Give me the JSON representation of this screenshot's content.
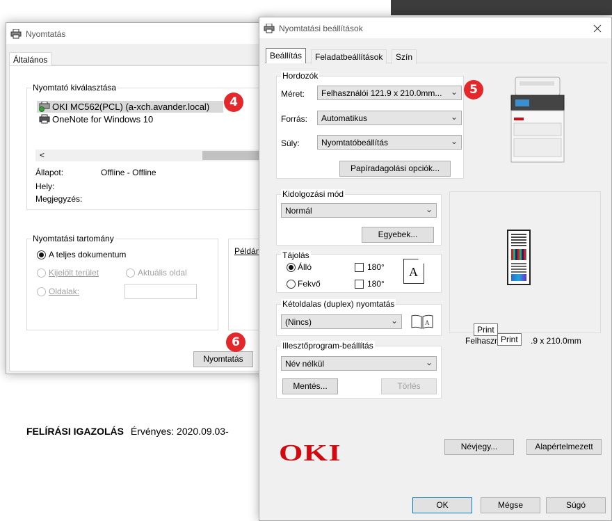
{
  "colors": {
    "badge": "#e3272a",
    "oki_logo": "#d10a10",
    "dark_bar": "#3c3c3c",
    "selection": "#d9d9d9"
  },
  "bg_text": {
    "certificate_label": "FELÍRÁSI IGAZOLÁS",
    "valid_text": "Érvényes: 2020.09.03-"
  },
  "print_dialog": {
    "title": "Nyomtatás",
    "title_icon": "printer-icon",
    "tab": "Általános",
    "select_printer_legend": "Nyomtató kiválasztása",
    "printers": [
      {
        "name": "OKI MC562(PCL) (a-xch.avander.local)",
        "icon": "network-printer-icon",
        "selected": true
      },
      {
        "name": "OneNote for Windows 10",
        "icon": "printer-icon",
        "selected": false
      }
    ],
    "scroll_left": "<",
    "status_label": "Állapot:",
    "status_value": "Offline - Offline",
    "location_label": "Hely:",
    "comment_label": "Megjegyzés:",
    "range_legend": "Nyomtatási tartomány",
    "range_all": "A teljes dokumentum",
    "range_selection": "Kijelölt terület",
    "range_current": "Aktuális oldal",
    "range_pages": "Oldalak:",
    "copies_label": "Példány",
    "print_button": "Nyomtatás"
  },
  "settings_dialog": {
    "title": "Nyomtatási beállítások",
    "title_icon": "printer-icon",
    "close_icon": "close-icon",
    "tabs": [
      "Beállítás",
      "Feladatbeállítások",
      "Szín"
    ],
    "active_tab": 0,
    "media_legend": "Hordozók",
    "size_label": "Méret:",
    "size_value": "Felhasználói 121.9 x 210.0mm...",
    "source_label": "Forrás:",
    "source_value": "Automatikus",
    "weight_label": "Súly:",
    "weight_value": "Nyomtatóbeállítás",
    "paper_feed_button": "Papíradagolási opciók...",
    "finishing_legend": "Kidolgozási mód",
    "finishing_value": "Normál",
    "other_button": "Egyebek...",
    "orientation_legend": "Tájolás",
    "portrait": "Álló",
    "landscape": "Fekvő",
    "rotate180_a": "180°",
    "rotate180_b": "180°",
    "orientation_icon_letter": "A",
    "duplex_legend": "Kétoldalas (duplex) nyomtatás",
    "duplex_value": "(Nincs)",
    "duplex_icon": "book-icon",
    "driver_legend": "Illesztőprogram-beállítás",
    "driver_value": "Név nélkül",
    "save_button": "Mentés...",
    "delete_button": "Törlés",
    "preview_caption_left": "Felhaszn",
    "preview_caption_right": ".9 x 210.0mm",
    "tooltip_a": "Print",
    "tooltip_b": "Print",
    "logo": "OKI",
    "about_button": "Névjegy...",
    "default_button": "Alapértelmezett",
    "ok_button": "OK",
    "cancel_button": "Mégse",
    "help_button": "Súgó"
  },
  "badges": [
    "4",
    "5",
    "6"
  ]
}
